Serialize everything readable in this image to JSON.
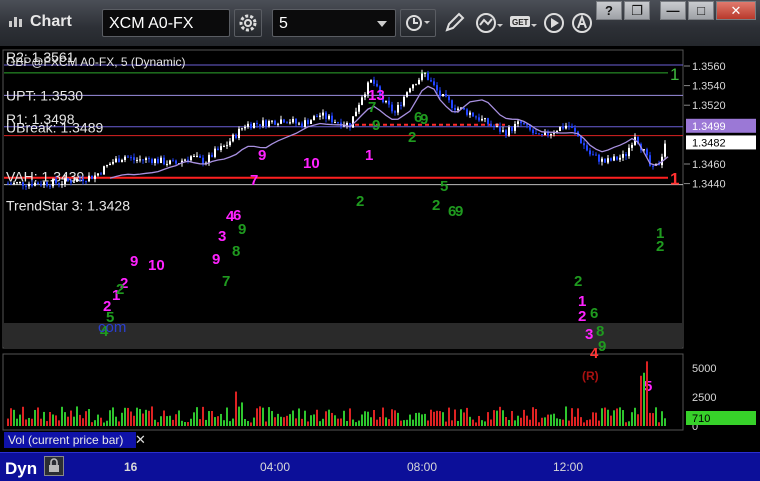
{
  "window": {
    "title": "Chart",
    "buttons": [
      "?",
      "❐",
      "—",
      "□",
      "✕"
    ]
  },
  "toolbar": {
    "symbol": "XCM A0-FX",
    "interval": "5"
  },
  "chart": {
    "study_title": "GBP@FXCM A0-FX, 5 (Dynamic)",
    "level_labels": [
      {
        "text": "R2: 1.3561",
        "price": 1.3561,
        "color": "#ffffff"
      },
      {
        "text": "UPT: 1.3530",
        "price": 1.353,
        "color": "#b9a4e8"
      },
      {
        "text": "R1: 1.3498",
        "price": 1.3498,
        "color": "#ffffff"
      },
      {
        "text": "UBreak: 1.3489",
        "price": 1.3489,
        "color": "#ff3333"
      },
      {
        "text": "VAH: 1.3439",
        "price": 1.3439,
        "color": "#ffffff"
      },
      {
        "text": "TrendStar 3: 1.3428",
        "price": 1.3428,
        "color": "#ffffff"
      }
    ],
    "price_axis": [
      "1.3560",
      "1.3540",
      "1.3520",
      "1.3499",
      "1.3482",
      "1.3460",
      "1.3440"
    ],
    "last_price_tag": "1.3482",
    "r1_tag": "1.3499",
    "right_markers": [
      {
        "text": "1",
        "color": "#3fb93f"
      },
      {
        "text": "1",
        "color": "#ff3030"
      }
    ],
    "reversal_marker": "R",
    "time_axis": [
      "16",
      "04:00",
      "08:00",
      "12:00"
    ],
    "watermark": "com"
  },
  "volume": {
    "label": "Vol (current price bar)",
    "axis": [
      "5000",
      "2500",
      "0"
    ],
    "last_tag": "710"
  },
  "bottom": {
    "mode": "Dyn"
  },
  "colors": {
    "up": "#ffffff",
    "down": "#2244ff",
    "magenta": "#ff22ff",
    "green": "#1f9a1f",
    "purple": "#a890e0"
  }
}
